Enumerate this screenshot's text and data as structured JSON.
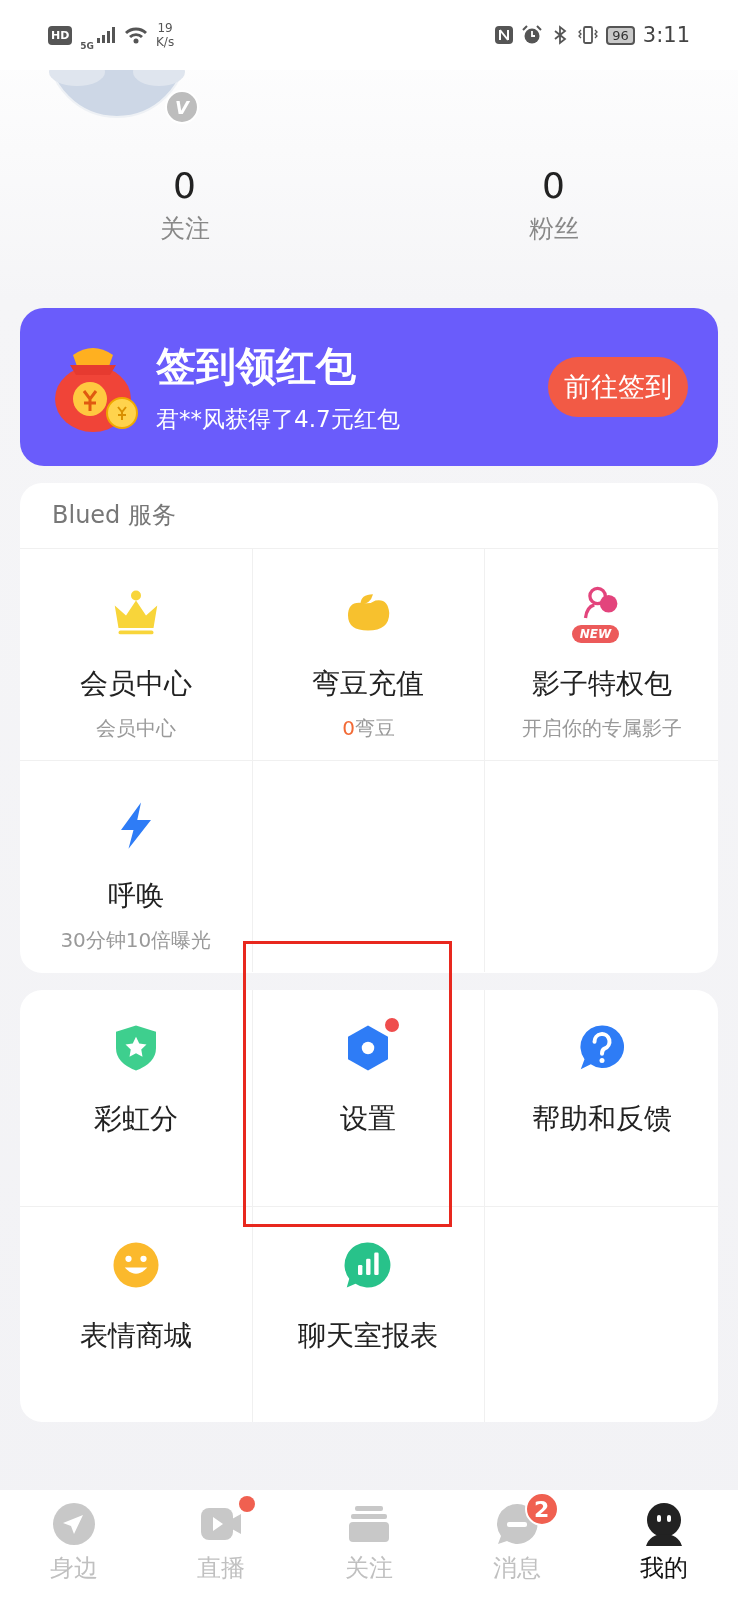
{
  "status_bar": {
    "hd": "HD",
    "network": "5G",
    "speed_value": "19",
    "speed_unit": "K/s",
    "battery": "96",
    "time": "3:11"
  },
  "profile": {
    "verified_mark": "V"
  },
  "stats": [
    {
      "value": "0",
      "label": "关注"
    },
    {
      "value": "0",
      "label": "粉丝"
    }
  ],
  "banner": {
    "title": "签到领红包",
    "subtitle": "君**风获得了4.7元红包",
    "button": "前往签到"
  },
  "services": {
    "title": "Blued 服务",
    "items": [
      {
        "kind": "crown",
        "title": "会员中心",
        "subtitle": "会员中心",
        "dot": false
      },
      {
        "kind": "bean",
        "title": "弯豆充值",
        "count": "0",
        "subtitle": "弯豆",
        "dot": false
      },
      {
        "kind": "shadow",
        "badge": "NEW",
        "title": "影子特权包",
        "subtitle": "开启你的专属影子",
        "dot": false
      },
      {
        "kind": "bolt",
        "title": "呼唤",
        "subtitle": "30分钟10倍曝光",
        "dot": false
      }
    ]
  },
  "tools": {
    "items": [
      {
        "kind": "shield",
        "title": "彩虹分",
        "dot": false
      },
      {
        "kind": "gear",
        "title": "设置",
        "dot": true
      },
      {
        "kind": "help",
        "title": "帮助和反馈",
        "dot": false
      },
      {
        "kind": "smile",
        "title": "表情商城",
        "dot": false
      },
      {
        "kind": "chart",
        "title": "聊天室报表",
        "dot": false
      }
    ]
  },
  "bottom_nav": [
    {
      "kind": "navigate",
      "label": "身边",
      "selected": false,
      "dot": false
    },
    {
      "kind": "video",
      "label": "直播",
      "selected": false,
      "dot": true
    },
    {
      "kind": "stack",
      "label": "关注",
      "selected": false,
      "dot": false
    },
    {
      "kind": "message",
      "label": "消息",
      "selected": false,
      "dot": false,
      "badge": "2"
    },
    {
      "kind": "me",
      "label": "我的",
      "selected": true,
      "dot": false
    }
  ]
}
